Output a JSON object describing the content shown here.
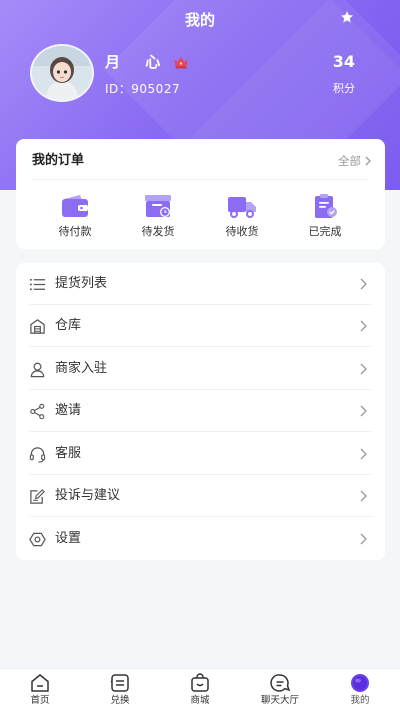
{
  "header": {
    "title": "我的",
    "accent": "#8b6cf3"
  },
  "profile": {
    "name": "月 心",
    "id_text": "ID：905027",
    "points_value": "34",
    "points_label": "积分"
  },
  "orders": {
    "title": "我的订单",
    "all_label": "全部",
    "items": [
      {
        "label": "待付款",
        "icon": "wallet-icon"
      },
      {
        "label": "待发货",
        "icon": "package-clock-icon"
      },
      {
        "label": "待收货",
        "icon": "truck-icon"
      },
      {
        "label": "已完成",
        "icon": "clipboard-check-icon"
      }
    ]
  },
  "menu": {
    "items": [
      {
        "label": "提货列表",
        "icon": "list-icon"
      },
      {
        "label": "仓库",
        "icon": "warehouse-icon"
      },
      {
        "label": "商家入驻",
        "icon": "user-icon"
      },
      {
        "label": "邀请",
        "icon": "share-icon"
      },
      {
        "label": "客服",
        "icon": "headset-icon"
      },
      {
        "label": "投诉与建议",
        "icon": "edit-icon"
      },
      {
        "label": "设置",
        "icon": "settings-icon"
      }
    ]
  },
  "tabbar": {
    "items": [
      {
        "label": "首页",
        "icon": "home-icon"
      },
      {
        "label": "兑换",
        "icon": "exchange-icon"
      },
      {
        "label": "商城",
        "icon": "shop-bag-icon"
      },
      {
        "label": "聊天大厅",
        "icon": "chat-icon"
      },
      {
        "label": "我的",
        "icon": "profile-icon",
        "active": true
      }
    ]
  }
}
